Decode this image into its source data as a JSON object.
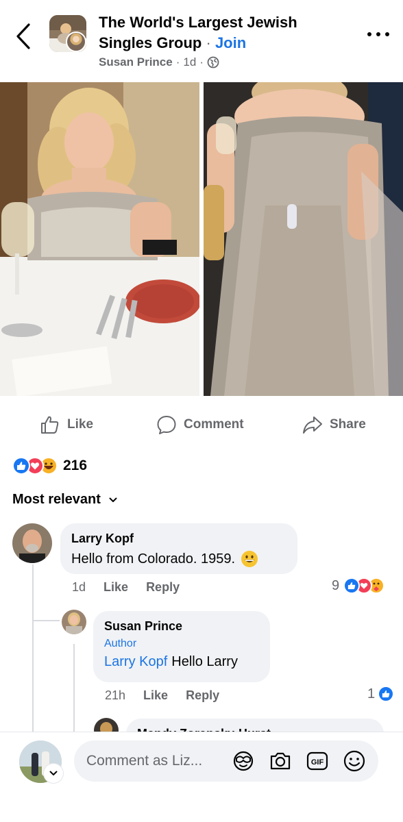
{
  "header": {
    "group_name": "The World's Largest Jewish Singles Group",
    "separator": "·",
    "join_label": "Join",
    "author": "Susan Prince",
    "time": "1d",
    "meta_separator": "·",
    "back_icon": "chevron-left-icon",
    "more_icon": "more-dots-icon",
    "privacy_icon": "globe-icon"
  },
  "actions": {
    "like": "Like",
    "comment": "Comment",
    "share": "Share"
  },
  "reactions": {
    "types": [
      "like",
      "love",
      "haha"
    ],
    "count": "216"
  },
  "sort": {
    "label": "Most relevant"
  },
  "comments": [
    {
      "name": "Larry Kopf",
      "text": "Hello from Colorado. 1959.",
      "emoji": "grinning-face",
      "time": "1d",
      "like": "Like",
      "reply": "Reply",
      "reaction_count": "9",
      "reaction_types": [
        "like",
        "love",
        "care"
      ]
    },
    {
      "name": "Susan Prince",
      "badge": "Author",
      "mention": "Larry Kopf",
      "text": "Hello Larry",
      "time": "21h",
      "like": "Like",
      "reply": "Reply",
      "reaction_count": "1",
      "reaction_types": [
        "like"
      ]
    },
    {
      "name": "Mandy Zoransky-Hurst"
    }
  ],
  "composer": {
    "placeholder": "Comment as Liz...",
    "icons": [
      "avatar-sticker-icon",
      "camera-icon",
      "gif-icon",
      "emoji-icon"
    ]
  },
  "colors": {
    "link_blue": "#1b74e4",
    "secondary_text": "#65676b",
    "bubble_bg": "#f0f2f5",
    "like_blue": "#1877f2",
    "love_red": "#f33e58",
    "haha_yellow": "#f7b125"
  }
}
